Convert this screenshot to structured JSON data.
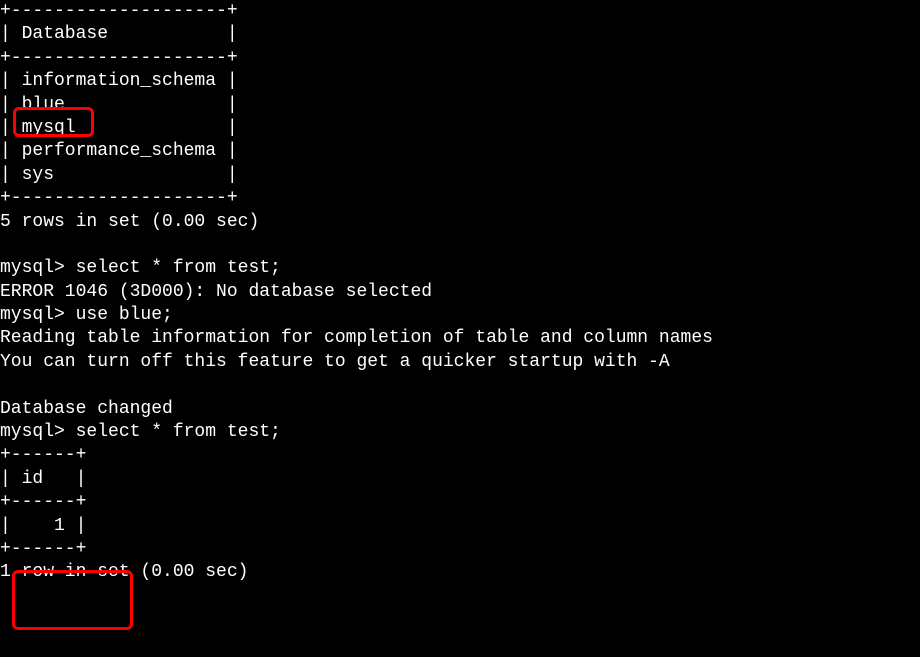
{
  "lines": {
    "l0": "+--------------------+",
    "l1": "| Database           |",
    "l2": "+--------------------+",
    "l3": "| information_schema |",
    "l4": "| blue               |",
    "l5": "| mysql              |",
    "l6": "| performance_schema |",
    "l7": "| sys                |",
    "l8": "+--------------------+",
    "l9": "5 rows in set (0.00 sec)",
    "l10": "",
    "l11": "mysql> select * from test;",
    "l12": "ERROR 1046 (3D000): No database selected",
    "l13": "mysql> use blue;",
    "l14": "Reading table information for completion of table and column names",
    "l15": "You can turn off this feature to get a quicker startup with -A",
    "l16": "",
    "l17": "Database changed",
    "l18": "mysql> select * from test;",
    "l19": "+------+",
    "l20": "| id   |",
    "l21": "+------+",
    "l22": "|    1 |",
    "l23": "+------+",
    "l24": "1 row in set (0.00 sec)"
  }
}
